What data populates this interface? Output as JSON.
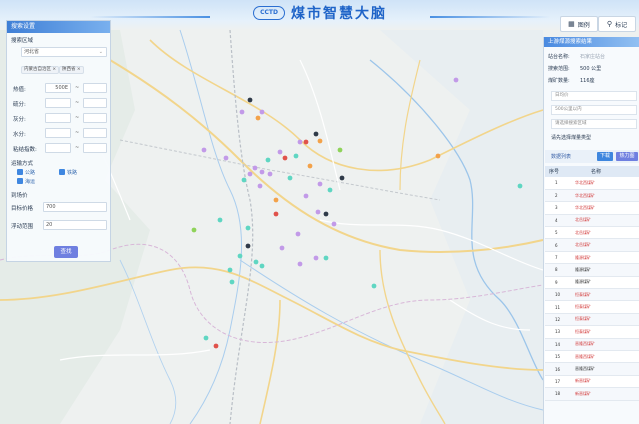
{
  "app": {
    "logo_text": "CCTD",
    "title": "煤市智慧大脑"
  },
  "toolbar": {
    "legend_label": "图例",
    "marker_label": "标记"
  },
  "left_panel": {
    "header": "搜索设置",
    "region_label": "搜索区域",
    "region_select": "河北省",
    "chips": [
      "内蒙古自治区",
      "陕西省"
    ],
    "params": [
      {
        "label": "热值:",
        "min": "500E",
        "max": ""
      },
      {
        "label": "硫分:",
        "min": "",
        "max": ""
      },
      {
        "label": "灰分:",
        "min": "",
        "max": ""
      },
      {
        "label": "水分:",
        "min": "",
        "max": ""
      },
      {
        "label": "粘结指数:",
        "min": "",
        "max": ""
      }
    ],
    "dash": "~",
    "transport_label": "运输方式",
    "transport_options": [
      "公路",
      "铁路",
      "海运"
    ],
    "price_section_label": "到场价",
    "target_price_label": "目标价格",
    "target_price_value": "700",
    "float_range_label": "浮动范围",
    "float_range_value": "20",
    "query_button": "查找"
  },
  "right_panel": {
    "header": "上游煤源搜索结果",
    "station_label": "站台名称:",
    "station_value": "石家庄站台",
    "range_label": "搜索范围:",
    "range_value": "500 公里",
    "count_label": "煤矿数量:",
    "count_value": "116座",
    "input_date": "日均价",
    "input_range": "500公里以内",
    "input_hint": "请选择搜索区域",
    "coal_type_label": "请先选择煤量类型",
    "data_list_label": "数据列表",
    "download_button": "下载",
    "heat_button": "热力图",
    "table_headers": [
      "序号",
      "名称"
    ],
    "rows": [
      {
        "no": "1",
        "name": "华北西煤矿",
        "red": true
      },
      {
        "no": "2",
        "name": "华北西煤矿",
        "red": true
      },
      {
        "no": "3",
        "name": "华北西煤矿",
        "red": true
      },
      {
        "no": "4",
        "name": "北岳煤矿",
        "red": true
      },
      {
        "no": "5",
        "name": "北岳煤矿",
        "red": true
      },
      {
        "no": "6",
        "name": "北岳煤矿",
        "red": true
      },
      {
        "no": "7",
        "name": "隆源煤矿",
        "red": true
      },
      {
        "no": "8",
        "name": "隆源煤矿",
        "red": false
      },
      {
        "no": "9",
        "name": "隆源煤矿",
        "red": false
      },
      {
        "no": "10",
        "name": "恒泰煤矿",
        "red": true
      },
      {
        "no": "11",
        "name": "恒泰煤矿",
        "red": true
      },
      {
        "no": "12",
        "name": "恒泰煤矿",
        "red": true
      },
      {
        "no": "13",
        "name": "恒泰煤矿",
        "red": true
      },
      {
        "no": "14",
        "name": "晋隆西煤矿",
        "red": true
      },
      {
        "no": "15",
        "name": "晋隆西煤矿",
        "red": true
      },
      {
        "no": "16",
        "name": "晋隆西煤矿",
        "red": false
      },
      {
        "no": "17",
        "name": "新晋煤矿",
        "red": true
      },
      {
        "no": "18",
        "name": "新晋煤矿",
        "red": true
      }
    ]
  },
  "colors": {
    "accent": "#3f7fd6",
    "query_button": "#6f7fe0",
    "marker_purple": "#c29ae8",
    "marker_teal": "#5fd6c2",
    "marker_red": "#e0524b",
    "marker_orange": "#f3a24a",
    "marker_dark": "#2f3a48",
    "marker_green": "#8fd35a"
  }
}
